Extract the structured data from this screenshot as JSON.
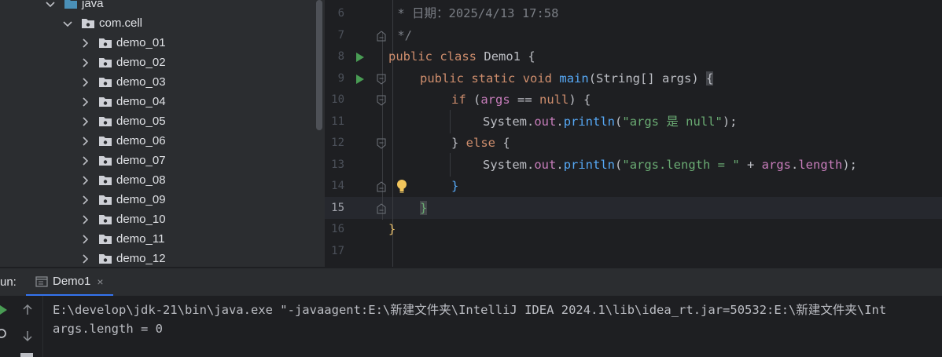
{
  "sidebar": {
    "items": [
      {
        "label": "java",
        "indent": 1,
        "expanded": true,
        "icon": "source-root-folder-icon"
      },
      {
        "label": "com.cell",
        "indent": 2,
        "expanded": true,
        "icon": "package-folder-icon"
      },
      {
        "label": "demo_01",
        "indent": 3,
        "expanded": false,
        "icon": "package-folder-icon"
      },
      {
        "label": "demo_02",
        "indent": 3,
        "expanded": false,
        "icon": "package-folder-icon"
      },
      {
        "label": "demo_03",
        "indent": 3,
        "expanded": false,
        "icon": "package-folder-icon"
      },
      {
        "label": "demo_04",
        "indent": 3,
        "expanded": false,
        "icon": "package-folder-icon"
      },
      {
        "label": "demo_05",
        "indent": 3,
        "expanded": false,
        "icon": "package-folder-icon"
      },
      {
        "label": "demo_06",
        "indent": 3,
        "expanded": false,
        "icon": "package-folder-icon"
      },
      {
        "label": "demo_07",
        "indent": 3,
        "expanded": false,
        "icon": "package-folder-icon"
      },
      {
        "label": "demo_08",
        "indent": 3,
        "expanded": false,
        "icon": "package-folder-icon"
      },
      {
        "label": "demo_09",
        "indent": 3,
        "expanded": false,
        "icon": "package-folder-icon"
      },
      {
        "label": "demo_10",
        "indent": 3,
        "expanded": false,
        "icon": "package-folder-icon"
      },
      {
        "label": "demo_11",
        "indent": 3,
        "expanded": false,
        "icon": "package-folder-icon"
      },
      {
        "label": "demo_12",
        "indent": 3,
        "expanded": false,
        "icon": "package-folder-icon"
      }
    ]
  },
  "editor": {
    "current_line": 15,
    "lines": [
      {
        "num": "6",
        "text": " * 日期：2025/4/13 17:58"
      },
      {
        "num": "7",
        "text": " */"
      },
      {
        "num": "8",
        "kw1": "public",
        "kw2": "class",
        "name": "Demo1",
        "rest": " {"
      },
      {
        "num": "9",
        "kw1": "public",
        "kw2": "static",
        "kw3": "void",
        "fn": "main",
        "rest": "(String[] args) ",
        "brace": "{"
      },
      {
        "num": "10",
        "kw": "if",
        "rest1": " (",
        "var": "args",
        "rest2": " == ",
        "kw2": "null",
        "rest3": ") {"
      },
      {
        "num": "11",
        "cls": "System",
        "dot1": ".",
        "fld": "out",
        "dot2": ".",
        "fn": "println",
        "open": "(",
        "str": "\"args 是 null\"",
        "close": ");"
      },
      {
        "num": "12",
        "text": "} ",
        "kw": "else",
        "rest": " {"
      },
      {
        "num": "13",
        "cls": "System",
        "dot1": ".",
        "fld": "out",
        "dot2": ".",
        "fn": "println",
        "open": "(",
        "str": "\"args.length = \"",
        "mid": " + ",
        "var": "args",
        "dot3": ".",
        "fld2": "length",
        "close": ");"
      },
      {
        "num": "14",
        "text": "}"
      },
      {
        "num": "15",
        "text": "}"
      },
      {
        "num": "16",
        "text": "}"
      },
      {
        "num": "17",
        "text": ""
      }
    ]
  },
  "run_panel": {
    "label": "un:",
    "tab_label": "Demo1",
    "tab_close": "×",
    "console": [
      "E:\\develop\\jdk-21\\bin\\java.exe \"-javaagent:E:\\新建文件夹\\IntelliJ IDEA 2024.1\\lib\\idea_rt.jar=50532:E:\\新建文件夹\\Int",
      "args.length = 0"
    ]
  },
  "colors": {
    "accent": "#3574f0",
    "run_green": "#499c54",
    "keyword": "#cf8e6d",
    "function": "#56a8f5",
    "string": "#6aab73",
    "field": "#c77dbb",
    "comment": "#7a7e85",
    "bulb": "#f2c55c"
  }
}
